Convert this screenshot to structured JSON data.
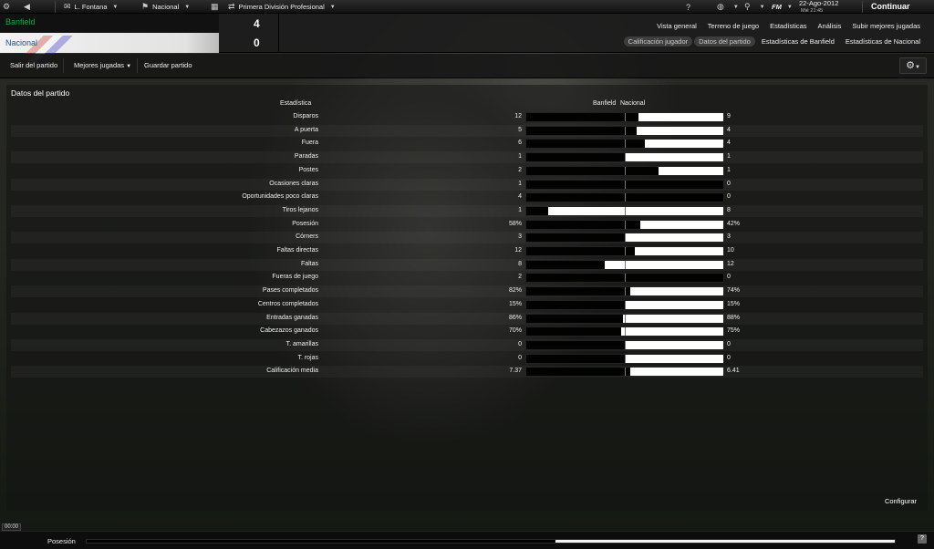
{
  "topbar": {
    "manager": "L. Fontana",
    "manager_badge": "8",
    "club": "Nacional",
    "competition": "Primera División Profesional",
    "date": "22-Ago-2012",
    "time": "Mié 21:45",
    "brand": "FM",
    "continue_label": "Continuar"
  },
  "match": {
    "home_team": "Banfield",
    "away_team": "Nacional",
    "home_score": "4",
    "away_score": "0",
    "home_color": "#12a83a",
    "away_color": "#1b4fcf"
  },
  "nav": {
    "row1": [
      "Vista general",
      "Terreno de juego",
      "Estadísticas",
      "Análisis",
      "Subir mejores jugadas"
    ],
    "row2": [
      "Calificación jugador",
      "Datos del partido",
      "Estadísticas de Banfield",
      "Estadísticas de Nacional"
    ],
    "active_row2": 1
  },
  "toolbar": {
    "exit_label": "Salir del partido",
    "highlights_label": "Mejores jugadas",
    "save_label": "Guardar partido"
  },
  "panel": {
    "title": "Datos del partido",
    "stat_header": "Estadística",
    "home_header": "Banfield",
    "away_header": "Nacional",
    "configure_label": "Configurar",
    "stats": [
      {
        "label": "Disparos",
        "home": "12",
        "away": "9",
        "home_share": 0.57
      },
      {
        "label": "A puerta",
        "home": "5",
        "away": "4",
        "home_share": 0.56
      },
      {
        "label": "Fuera",
        "home": "6",
        "away": "4",
        "home_share": 0.6
      },
      {
        "label": "Paradas",
        "home": "1",
        "away": "1",
        "home_share": 0.5
      },
      {
        "label": "Postes",
        "home": "2",
        "away": "1",
        "home_share": 0.67
      },
      {
        "label": "Ocasiones claras",
        "home": "1",
        "away": "0",
        "home_share": 1.0
      },
      {
        "label": "Oportunidades poco claras",
        "home": "4",
        "away": "0",
        "home_share": 1.0
      },
      {
        "label": "Tiros lejanos",
        "home": "1",
        "away": "8",
        "home_share": 0.11
      },
      {
        "label": "Posesión",
        "home": "58%",
        "away": "42%",
        "home_share": 0.58
      },
      {
        "label": "Córners",
        "home": "3",
        "away": "3",
        "home_share": 0.5
      },
      {
        "label": "Faltas directas",
        "home": "12",
        "away": "10",
        "home_share": 0.55
      },
      {
        "label": "Faltas",
        "home": "8",
        "away": "12",
        "home_share": 0.4
      },
      {
        "label": "Fueras de juego",
        "home": "2",
        "away": "0",
        "home_share": 1.0
      },
      {
        "label": "Pases completados",
        "home": "82%",
        "away": "74%",
        "home_share": 0.53
      },
      {
        "label": "Centros completados",
        "home": "15%",
        "away": "15%",
        "home_share": 0.5
      },
      {
        "label": "Entradas ganadas",
        "home": "86%",
        "away": "88%",
        "home_share": 0.49
      },
      {
        "label": "Cabezazos ganados",
        "home": "70%",
        "away": "75%",
        "home_share": 0.48
      },
      {
        "label": "T. amarillas",
        "home": "0",
        "away": "0",
        "home_share": 0.5
      },
      {
        "label": "T. rojas",
        "home": "0",
        "away": "0",
        "home_share": 0.5
      },
      {
        "label": "Calificación media",
        "home": "7.37",
        "away": "6.41",
        "home_share": 0.53
      }
    ]
  },
  "bottom": {
    "clock": "00:00",
    "possession_label": "Posesión",
    "possession_home": 0.58
  }
}
